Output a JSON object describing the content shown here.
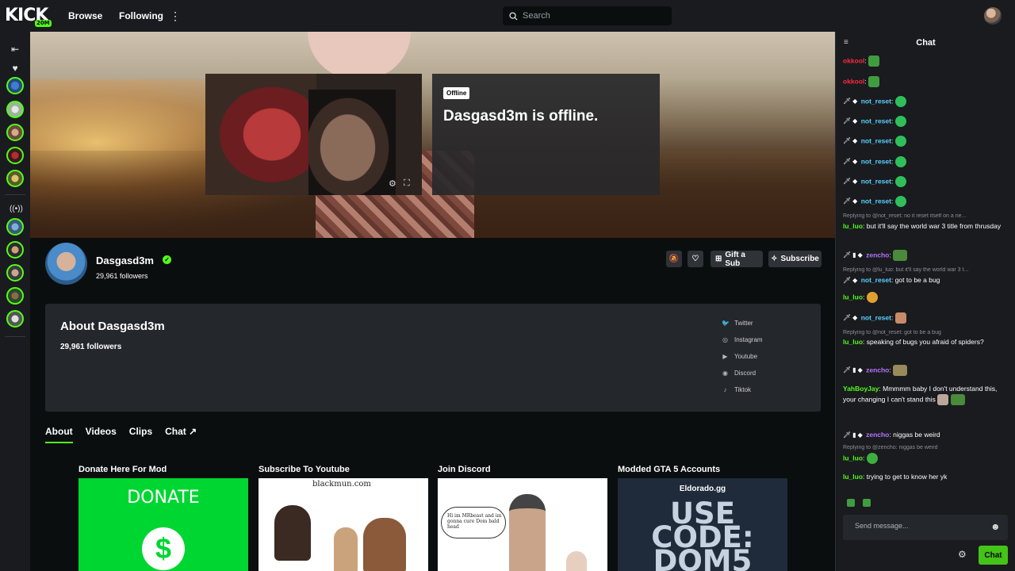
{
  "topbar": {
    "logo": "KICK",
    "logo_badge": "20M",
    "browse": "Browse",
    "following": "Following",
    "more": "⋮",
    "search_placeholder": "Search"
  },
  "player": {
    "offline_badge": "Offline",
    "offline_text": "Dasgasd3m is offline."
  },
  "channel": {
    "name": "Dasgasd3m",
    "followers": "29,961 followers",
    "gift_sub": "Gift a Sub",
    "subscribe": "Subscribe"
  },
  "about": {
    "title": "About Dasgasd3m",
    "followers": "29,961 followers",
    "socials": [
      "Twitter",
      "Instagram",
      "Youtube",
      "Discord",
      "Tiktok"
    ]
  },
  "tabs": [
    "About",
    "Videos",
    "Clips",
    "Chat ↗"
  ],
  "panels": [
    {
      "title": "Donate Here For Mod",
      "image_text": "DONATE"
    },
    {
      "title": "Subscribe To Youtube",
      "image_text": "blackmun.com"
    },
    {
      "title": "Join Discord",
      "image_text": "Hi im MRbeast and im gonna cure Dom bald head"
    },
    {
      "title": "Modded GTA 5 Accounts",
      "image_text": "Eldorado.gg",
      "image_text2": "USE CODE: DOM5"
    }
  ],
  "chat": {
    "title": "Chat",
    "messages": [
      {
        "user": "okkool",
        "text": ""
      },
      {
        "user": "okkool",
        "text": ""
      },
      {
        "user": "not_reset",
        "text": ""
      },
      {
        "user": "not_reset",
        "text": ""
      },
      {
        "user": "not_reset",
        "text": ""
      },
      {
        "user": "not_reset",
        "text": ""
      },
      {
        "user": "not_reset",
        "text": ""
      },
      {
        "user": "not_reset",
        "text": ""
      },
      {
        "reply": "Replying to @not_reset: no it reset itself on a ne...",
        "user": "lu_luo",
        "text": "but it'll say the world war 3 title from thrusday"
      },
      {
        "user": "zencho",
        "text": ""
      },
      {
        "reply": "Replying to @lu_luo: but it'll say the world war 3 t...",
        "user": "not_reset",
        "text": "got to be a bug"
      },
      {
        "user": "lu_luo",
        "text": ""
      },
      {
        "user": "not_reset",
        "text": ""
      },
      {
        "reply": "Replying to @not_reset: got to be a bug",
        "user": "lu_luo",
        "text": "speaking of bugs you afraid of spiders?"
      },
      {
        "user": "zencho",
        "text": ""
      },
      {
        "user": "YahBoyJay",
        "text": "Mmmmm baby I don't understand this, your changing I can't stand this"
      },
      {
        "user": "zencho",
        "text": "niggas be weird"
      },
      {
        "reply": "Replying to @zencho: niggas be weird",
        "user": "lu_luo",
        "text": ""
      },
      {
        "user": "lu_luo",
        "text": "trying to get to know her yk"
      }
    ],
    "input_placeholder": "Send message...",
    "send": "Chat"
  },
  "colors": {
    "accent": "#53fc18",
    "okkool": "#ff2a3d",
    "not_reset": "#5ad1ff",
    "lu_luo": "#53fc18",
    "zencho": "#b574ff",
    "YahBoyJay": "#53fc18"
  },
  "icons": {
    "search": "search-icon",
    "menu": "menu-icon",
    "heart": "heart-icon",
    "broadcast": "broadcast-icon",
    "gear": "gear-icon",
    "fullscreen": "fullscreen-icon",
    "bell_off": "bell-off-icon",
    "heart_btn": "heart-icon",
    "gift": "gift-icon",
    "star": "star-icon",
    "verified": "verified-icon",
    "emoji": "emoji-icon"
  }
}
